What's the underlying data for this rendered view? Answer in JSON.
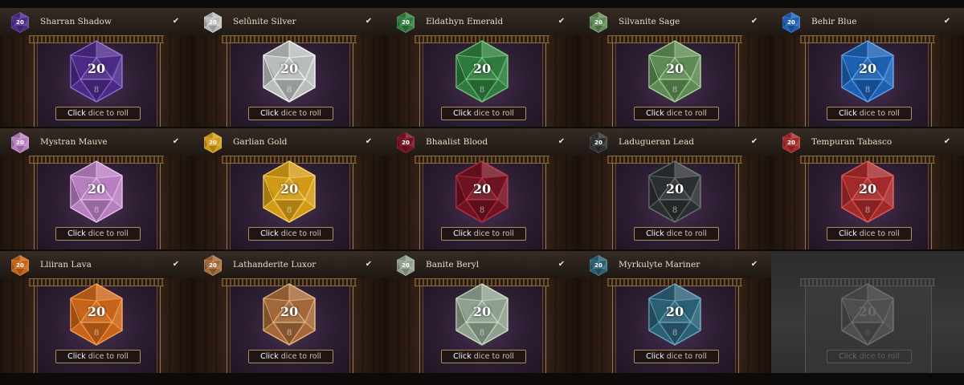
{
  "dice": [
    {
      "name": "Sharran Shadow",
      "color": "#4b2a86",
      "edge": "#8f6bd0",
      "selected": true
    },
    {
      "name": "Selûnite Silver",
      "color": "#b8bdbb",
      "edge": "#f3f4f1",
      "selected": true
    },
    {
      "name": "Eldathyn Emerald",
      "color": "#2f7a3d",
      "edge": "#6cc77a",
      "selected": true
    },
    {
      "name": "Silvanite Sage",
      "color": "#5f8a55",
      "edge": "#a8cf95",
      "selected": true
    },
    {
      "name": "Behir Blue",
      "color": "#1d5fb0",
      "edge": "#5aa2ee",
      "selected": true
    },
    {
      "name": "Mystran Mauve",
      "color": "#b77fc0",
      "edge": "#e8b9ee",
      "selected": true
    },
    {
      "name": "Garlian Gold",
      "color": "#d39a17",
      "edge": "#f6cf62",
      "selected": true
    },
    {
      "name": "Bhaalist Blood",
      "color": "#6e1322",
      "edge": "#b7303f",
      "selected": true
    },
    {
      "name": "Ladugueran Lead",
      "color": "#2c2f31",
      "edge": "#6a7072",
      "selected": true
    },
    {
      "name": "Tempuran Tabasco",
      "color": "#a32a2c",
      "edge": "#e15b56",
      "selected": true
    },
    {
      "name": "Lliiran Lava",
      "color": "#c8641a",
      "edge": "#f3a04c",
      "selected": true
    },
    {
      "name": "Lathanderite Luxor",
      "color": "#a3683a",
      "edge": "#e3b57c",
      "selected": true
    },
    {
      "name": "Banite Beryl",
      "color": "#8ea08e",
      "edge": "#c9dcc4",
      "selected": true
    },
    {
      "name": "Myrkulyte Mariner",
      "color": "#2b5f73",
      "edge": "#6aa7bc",
      "selected": true
    },
    {
      "name": "",
      "color": "#4e4e4e",
      "edge": "#6e6e6e",
      "selected": false,
      "placeholder": true
    }
  ],
  "die_face_number": "20",
  "die_small_number": "8",
  "swatch_number": "20",
  "check_mark": "✔",
  "roll_label_prefix": "Click",
  "roll_label_suffix": "dice to roll"
}
